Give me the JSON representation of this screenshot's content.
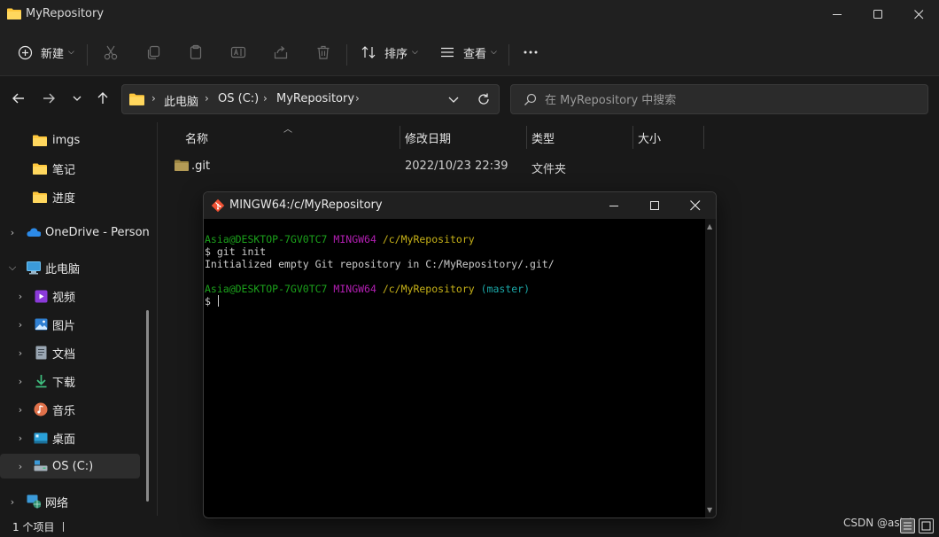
{
  "window": {
    "title": "MyRepository"
  },
  "toolbar": {
    "new_label": "新建",
    "sort_label": "排序",
    "view_label": "查看"
  },
  "address": {
    "segments": [
      "此电脑",
      "OS (C:)",
      "MyRepository"
    ]
  },
  "search": {
    "placeholder": "在 MyRepository 中搜索"
  },
  "sidebar": {
    "items": [
      {
        "label": "imgs",
        "icon": "folder-icon"
      },
      {
        "label": "笔记",
        "icon": "folder-icon"
      },
      {
        "label": "进度",
        "icon": "folder-icon"
      },
      {
        "label": "OneDrive - Person",
        "icon": "cloud-icon"
      },
      {
        "label": "此电脑",
        "icon": "computer-icon"
      },
      {
        "label": "视频",
        "icon": "video-icon"
      },
      {
        "label": "图片",
        "icon": "picture-icon"
      },
      {
        "label": "文档",
        "icon": "document-icon"
      },
      {
        "label": "下载",
        "icon": "download-icon"
      },
      {
        "label": "音乐",
        "icon": "music-icon"
      },
      {
        "label": "桌面",
        "icon": "desktop-icon"
      },
      {
        "label": "OS (C:)",
        "icon": "drive-icon"
      },
      {
        "label": "网络",
        "icon": "network-icon"
      }
    ]
  },
  "filelist": {
    "columns": [
      "名称",
      "修改日期",
      "类型",
      "大小"
    ],
    "rows": [
      {
        "name": ".git",
        "modified": "2022/10/23 22:39",
        "type": "文件夹",
        "size": ""
      }
    ]
  },
  "status": {
    "item_count": "1 个项目"
  },
  "watermark": "CSDN @asiyi",
  "terminal": {
    "title": "MINGW64:/c/MyRepository",
    "prompt1": {
      "user": "Asia@DESKTOP-7GV0TC7",
      "env": "MINGW64",
      "path": "/c/MyRepository"
    },
    "command": "$ git init",
    "output": "Initialized empty Git repository in C:/MyRepository/.git/",
    "prompt2": {
      "user": "Asia@DESKTOP-7GV0TC7",
      "env": "MINGW64",
      "path": "/c/MyRepository",
      "branch": "(master)"
    },
    "prompt_symbol": "$"
  },
  "colors": {
    "accent": "#ffc83d",
    "terminal_green": "#1ba11b",
    "terminal_purple": "#b31fb3",
    "terminal_yellow": "#c7b218",
    "terminal_cyan": "#1ba8a8"
  }
}
